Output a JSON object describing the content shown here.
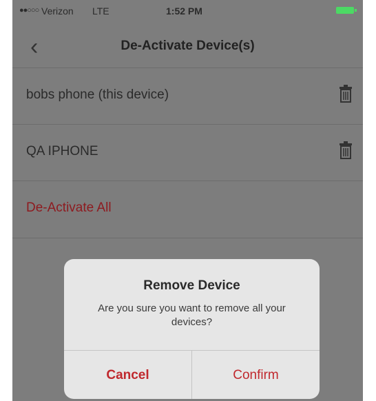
{
  "status_bar": {
    "signal": "●●○○○",
    "carrier": "Verizon",
    "network": "LTE",
    "time": "1:52 PM"
  },
  "nav": {
    "title": "De-Activate Device(s)",
    "back_icon": "chevron-left-icon"
  },
  "devices": [
    {
      "label": "bobs phone (this device)",
      "icon": "trash-icon"
    },
    {
      "label": "QA IPHONE",
      "icon": "trash-icon"
    }
  ],
  "deactivate_all_label": "De-Activate All",
  "modal": {
    "title": "Remove Device",
    "message": "Are you sure you want to remove all your devices?",
    "cancel_label": "Cancel",
    "confirm_label": "Confirm"
  },
  "colors": {
    "accent_red": "#c0282d",
    "battery_green": "#4cd964",
    "dim_overlay": "#7d7d7d"
  }
}
